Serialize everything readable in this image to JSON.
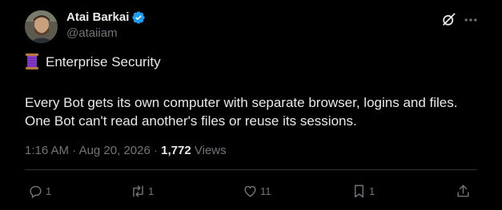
{
  "author": {
    "name": "Atai Barkai",
    "handle": "@ataiiam",
    "verified": true
  },
  "post": {
    "heading_emoji": "spool-of-thread",
    "heading": "Enterprise Security",
    "body_line_1": "Every Bot gets its own computer with separate browser, logins and files.",
    "body_line_2": "One Bot can't read another's files or reuse its sessions."
  },
  "meta": {
    "time": "1:16 AM",
    "date": "Aug 20, 2026",
    "separator": "·",
    "views_count": "1,772",
    "views_label": "Views"
  },
  "actions": {
    "replies": "1",
    "reposts": "1",
    "likes": "11",
    "bookmarks": "1"
  },
  "colors": {
    "background": "#000000",
    "text": "#e7e9ea",
    "muted": "#71767b",
    "verified": "#1d9bf0",
    "divider": "#2f3336"
  },
  "icons": [
    "verified-badge-icon",
    "grok-icon",
    "more-icon",
    "spool-icon",
    "reply-icon",
    "repost-icon",
    "like-icon",
    "bookmark-icon",
    "share-icon"
  ]
}
